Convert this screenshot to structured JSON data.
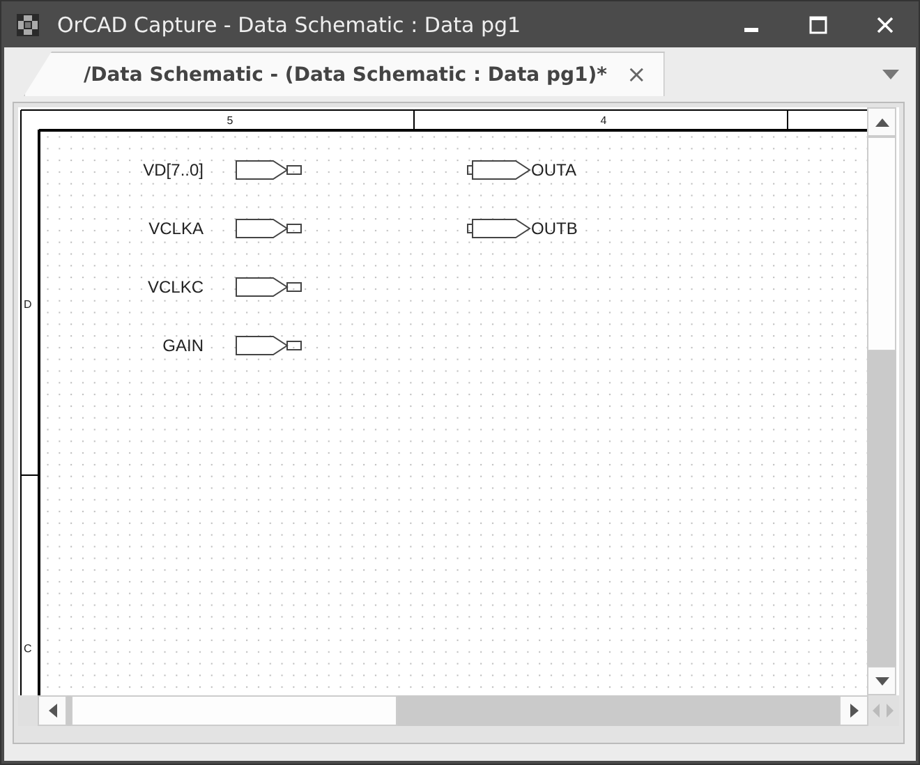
{
  "window": {
    "title": "OrCAD Capture - Data Schematic : Data pg1"
  },
  "tabs": [
    {
      "label": "/Data Schematic - (Data Schematic : Data pg1)*",
      "selected": true,
      "close": "×"
    }
  ],
  "schematic": {
    "column_zones": [
      "5",
      "4"
    ],
    "row_zones": [
      "D",
      "C"
    ],
    "ports": [
      {
        "label": "VD[7..0]",
        "kind": "input"
      },
      {
        "label": "VCLKA",
        "kind": "input"
      },
      {
        "label": "VCLKC",
        "kind": "input"
      },
      {
        "label": "GAIN",
        "kind": "input"
      },
      {
        "label": "OUTA",
        "kind": "output"
      },
      {
        "label": "OUTB",
        "kind": "output"
      }
    ]
  }
}
